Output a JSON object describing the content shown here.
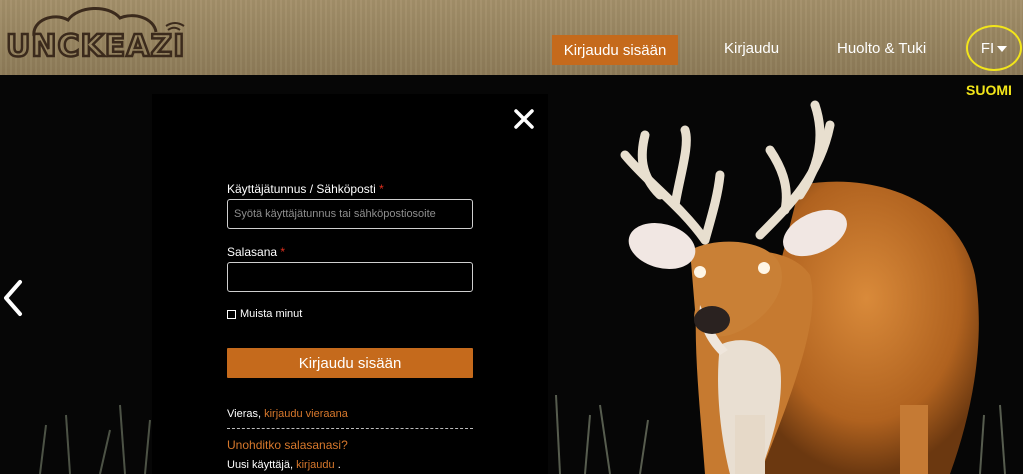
{
  "header": {
    "logo_text": "UNCKEAZI",
    "nav": {
      "login_active": "Kirjaudu sisään",
      "login": "Kirjaudu",
      "support": "Huolto & Tuki"
    },
    "language": {
      "code": "FI",
      "tooltip": "SUOMI"
    }
  },
  "login_panel": {
    "username_label": "Käyttäjätunnus / Sähköposti",
    "username_placeholder": "Syötä käyttäjätunnus tai sähköpostiosoite",
    "password_label": "Salasana",
    "required_mark": "*",
    "remember_label": "Muista minut",
    "submit_label": "Kirjaudu sisään",
    "guest_prefix": "Vieras,",
    "guest_link": "kirjaudu vieraana",
    "forgot_link": "Unohditko salasanasi?",
    "new_user_prefix": "Uusi käyttäjä,",
    "new_user_link": "kirjaudu",
    "new_user_suffix": "."
  },
  "colors": {
    "accent": "#c56a1c",
    "header_bg": "#9a8762",
    "highlight": "#f2e51a",
    "required": "#e0301e"
  },
  "icons": {
    "close": "close-icon",
    "left_arrow": "chevron-left-icon",
    "caret": "caret-down-icon"
  }
}
